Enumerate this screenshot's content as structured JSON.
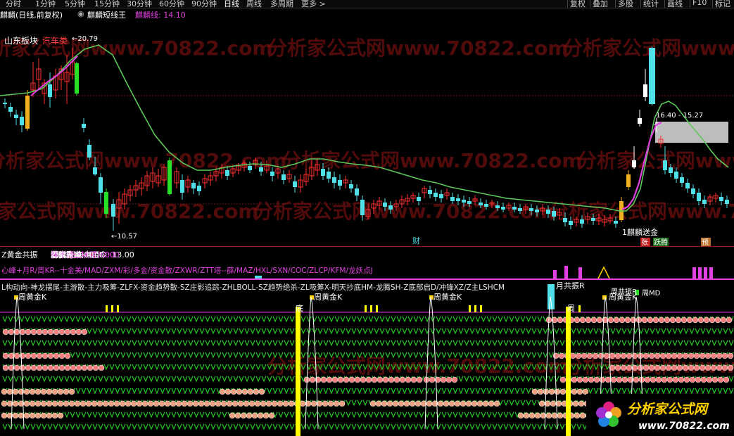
{
  "toolbar": {
    "timeframes": [
      "分时",
      "1分钟",
      "5分钟",
      "15分钟",
      "30分钟",
      "60分钟",
      "90分钟",
      "日线",
      "周线",
      "多周期",
      "更多 >"
    ],
    "active_timeframe": "日线",
    "buttons": [
      "复权",
      "叠加",
      "多股",
      "统计",
      "画线",
      "F10",
      "标记"
    ]
  },
  "title": {
    "stock_name": "麒麟(日线,前复权)",
    "indicator_name": "麒麟短线王",
    "indicator_value_label": "麒麟线: 14.10"
  },
  "main_chart": {
    "labels": {
      "sector": "山东板块",
      "concept": "汽车类",
      "high_mark": "20.79",
      "low_mark": "10.57",
      "zone_label": "16.40 - 15.27",
      "send_gold": "1麒麟送金",
      "cai": "财",
      "zhang": "张",
      "yuejing": "跃腾",
      "yu": "预"
    },
    "colors": {
      "up": "#ff3030",
      "down": "#4fe0e8",
      "ma": "#4fc34f",
      "pink": "#e040e0",
      "yellow": "#f0b020",
      "green": "#28e028"
    }
  },
  "indicator_1": {
    "name": "Z黄金共振",
    "items": [
      {
        "label": "穿阳箭:",
        "value": "0.00",
        "color": "#ff4040"
      },
      {
        "label": "前30日高点至今:",
        "value": "13.00",
        "color": "#ffffff"
      },
      {
        "label": "稳赢介入:",
        "value": "0.00",
        "color": "#ffffff"
      },
      {
        "label": "金叉E50M5:",
        "value": "0.00",
        "color": "#e040e0"
      },
      {
        "label": "短线买卖:",
        "value": "-",
        "color": "#ffffff"
      },
      {
        "label": "急卖奇准:",
        "value": "0.00",
        "color": "#4060ff"
      },
      {
        "label": "短卖奇准:",
        "value": "0.00",
        "color": "#ffffff"
      },
      {
        "label": "急买奇准:",
        "value": "0.00",
        "color": "#ffffff"
      },
      {
        "label": "短买奇准:",
        "value": "0.00",
        "color": "#ffffff"
      },
      {
        "label": "神不错上决顶:",
        "value": "0.00",
        "color": "#e040e0"
      },
      {
        "label": "Z筹爆:",
        "value": "0.00",
        "color": "#ffffff"
      }
    ]
  },
  "indicator_2": {
    "text": "心峰+月R/周KR--十金美/MAD/ZXM/彩/多金/资金散/ZXWR/ZTT塔--薛/MAZ/HXL/SXN/COC/ZLCP/KFM/龙妖点J"
  },
  "indicator_3": {
    "text": "L构动向-神龙摆尾-主游散-主力吸筹-ZLFX-资金趋势散-SZ庄影追踪-ZHLBOLL-SZ趋势绝杀-ZL吸筹X-明天抄底HM-龙腾SH-Z底部启D/冲锋XZ/Z主LSHCM",
    "labels": {
      "weekly_gold_k": "周黄金K",
      "monthly_resonance": "月共振R",
      "di": "底",
      "zhou": "周",
      "zhou_md": "周MD",
      "weekly_resonance": "周共振R"
    }
  },
  "watermark": "分析家公式网www.70822.com",
  "logo": {
    "text": "分析家公式网",
    "url": "www.70822.com"
  }
}
